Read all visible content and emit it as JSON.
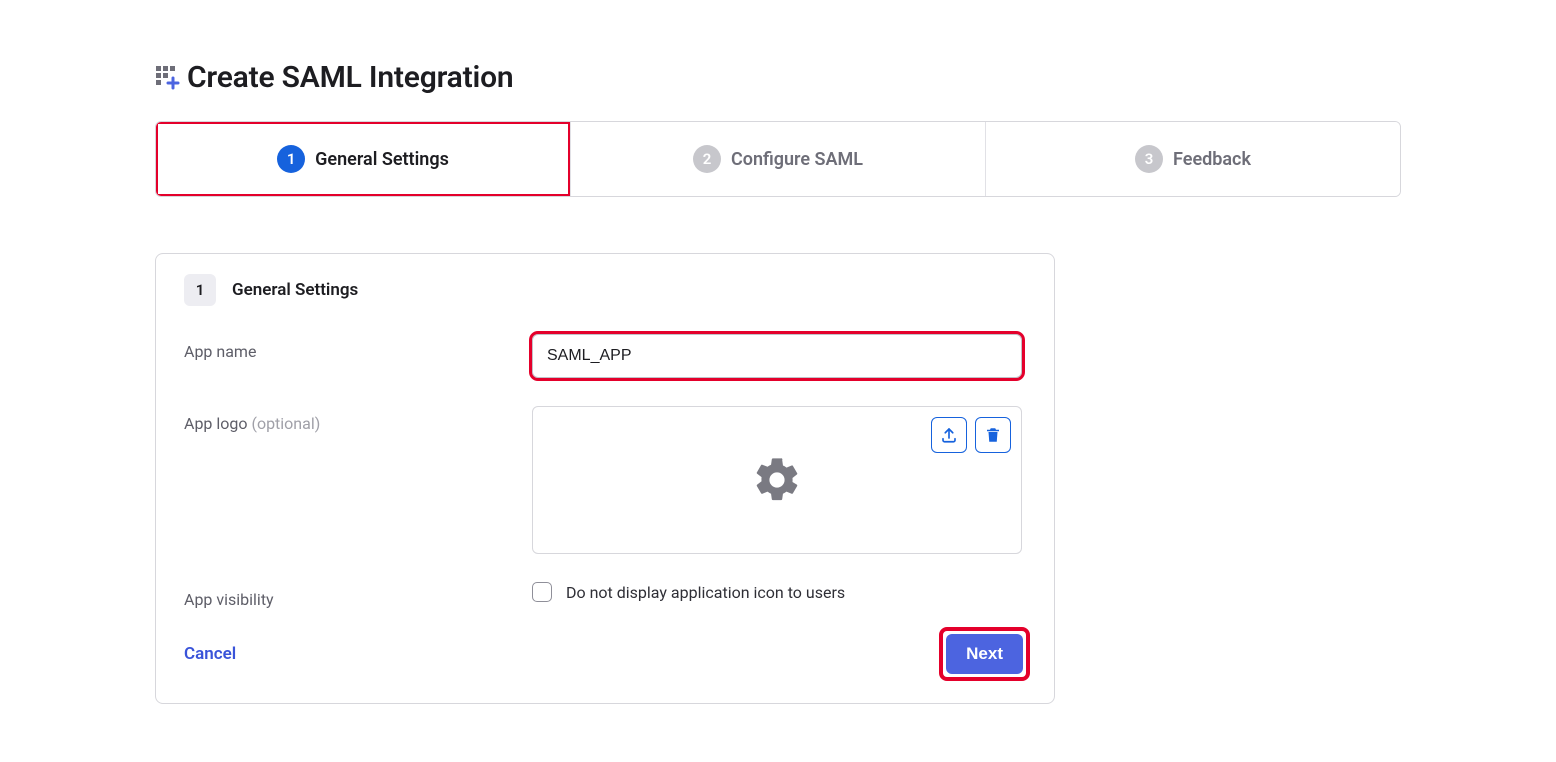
{
  "header": {
    "title": "Create SAML Integration"
  },
  "stepper": {
    "steps": [
      {
        "num": "1",
        "label": "General Settings",
        "active": true,
        "highlighted": true
      },
      {
        "num": "2",
        "label": "Configure SAML",
        "active": false,
        "highlighted": false
      },
      {
        "num": "3",
        "label": "Feedback",
        "active": false,
        "highlighted": false
      }
    ]
  },
  "panel": {
    "step_num": "1",
    "title": "General Settings",
    "fields": {
      "app_name": {
        "label": "App name",
        "value": "SAML_APP",
        "highlighted": true
      },
      "app_logo": {
        "label": "App logo",
        "optional": "(optional)"
      },
      "app_visibility": {
        "label": "App visibility",
        "checkbox_label": "Do not display application icon to users"
      }
    },
    "footer": {
      "cancel": "Cancel",
      "next": "Next",
      "next_highlighted": true
    }
  }
}
